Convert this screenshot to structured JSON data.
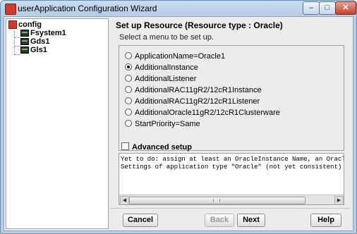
{
  "window": {
    "title": "userApplication Configuration Wizard",
    "controls": {
      "minimize": "–",
      "maximize": "□",
      "close": "✕"
    }
  },
  "tree": {
    "root": {
      "label": "config",
      "icon": "config-root-icon"
    },
    "children": [
      {
        "label": "Fsystem1",
        "icon": "resource-icon"
      },
      {
        "label": "Gds1",
        "icon": "resource-icon"
      },
      {
        "label": "Gls1",
        "icon": "resource-icon"
      }
    ]
  },
  "main": {
    "heading": "Set up Resource (Resource type : Oracle)",
    "instruction": "Select a menu to be set up.",
    "options": [
      {
        "label": "ApplicationName=Oracle1",
        "selected": false
      },
      {
        "label": "AdditionalInstance",
        "selected": true
      },
      {
        "label": "AdditionalListener",
        "selected": false
      },
      {
        "label": "AdditionalRAC11gR2/12cR1Instance",
        "selected": false
      },
      {
        "label": "AdditionalRAC11gR2/12cR1Listener",
        "selected": false
      },
      {
        "label": "AdditionalOracle11gR2/12cR1Clusterware",
        "selected": false
      },
      {
        "label": "StartPriority=Same",
        "selected": false
      }
    ],
    "advanced_setup": {
      "label": "Advanced setup",
      "checked": false
    },
    "messages": [
      "Yet to do: assign at least an OracleInstance Name, an OracleListener",
      "Settings of application type \"Oracle\" (not yet consistent)"
    ]
  },
  "buttons": {
    "cancel": "Cancel",
    "back": "Back",
    "next": "Next",
    "help": "Help"
  }
}
